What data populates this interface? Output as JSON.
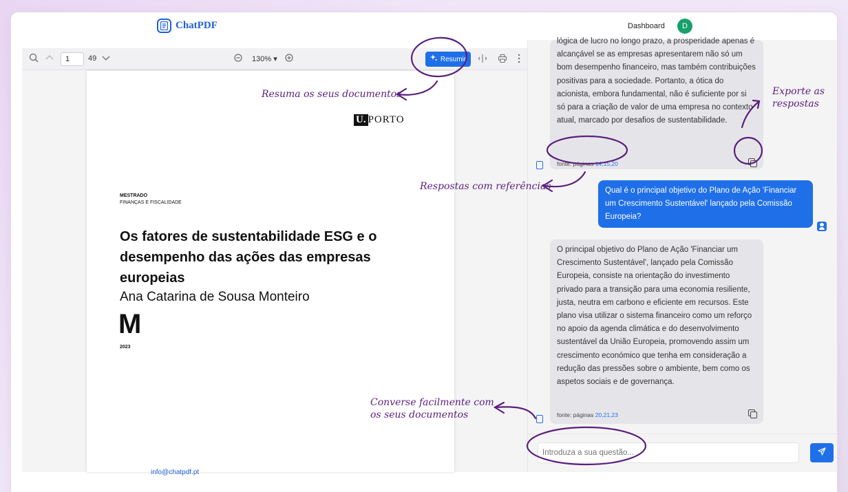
{
  "header": {
    "brand": "ChatPDF",
    "dashboard_label": "Dashboard",
    "avatar_letter": "D"
  },
  "pdf_viewer": {
    "current_page": "1",
    "total_pages": "49",
    "zoom": "130%",
    "summarize_label": "Resumir"
  },
  "pdf_document": {
    "logo_u": "U.",
    "logo_porto": "PORTO",
    "degree": "MESTRADO",
    "program": "FINANÇAS E FISCALIDADE",
    "title": "Os fatores de sustentabilidade ESG e o desempenho das ações das empresas europeias",
    "author": "Ana Catarina de Sousa Monteiro",
    "monogram": "M",
    "year": "2023"
  },
  "chat": {
    "messages": [
      {
        "role": "assistant",
        "text": "lógica de lucro no longo prazo, a prosperidade apenas é alcançável se as empresas apresentarem não só um bom desempenho financeiro, mas também contribuições positivas para a sociedade. Portanto, a ótica do acionista, embora fundamental, não é suficiente por si só para a criação de valor de uma empresa no contexto atual, marcado por desafios de sustentabilidade.",
        "source_label": "fonte: páginas",
        "source_pages": "14,15,20"
      },
      {
        "role": "user",
        "text": "Qual é o principal objetivo do Plano de Ação 'Financiar um Crescimento Sustentável' lançado pela Comissão Europeia?"
      },
      {
        "role": "assistant",
        "text": "O principal objetivo do Plano de Ação 'Financiar um Crescimento Sustentável', lançado pela Comissão Europeia, consiste na orientação do investimento privado para a transição para uma economia resiliente, justa, neutra em carbono e eficiente em recursos. Este plano visa utilizar o sistema financeiro como um reforço no apoio da agenda climática e do desenvolvimento sustentável da União Europeia, promovendo assim um crescimento económico que tenha em consideração a redução das pressões sobre o ambiente, bem como os aspetos sociais e de governança.",
        "source_label": "fonte: páginas",
        "source_pages": "20,21,23"
      }
    ],
    "input_placeholder": "Introduza a sua questão..."
  },
  "annotations": {
    "summarize": "Resuma os seus documentos",
    "export_line1": "Exporte as",
    "export_line2": "respostas",
    "references": "Respostas com referências",
    "converse_line1": "Converse facilmente com",
    "converse_line2": "os seus documentos"
  },
  "footer": {
    "email": "info@chatpdf.pt"
  },
  "colors": {
    "accent": "#1f6fe8",
    "brand": "#1f5fd8",
    "annotation": "#5a1e7c",
    "avatar": "#17a06a"
  }
}
